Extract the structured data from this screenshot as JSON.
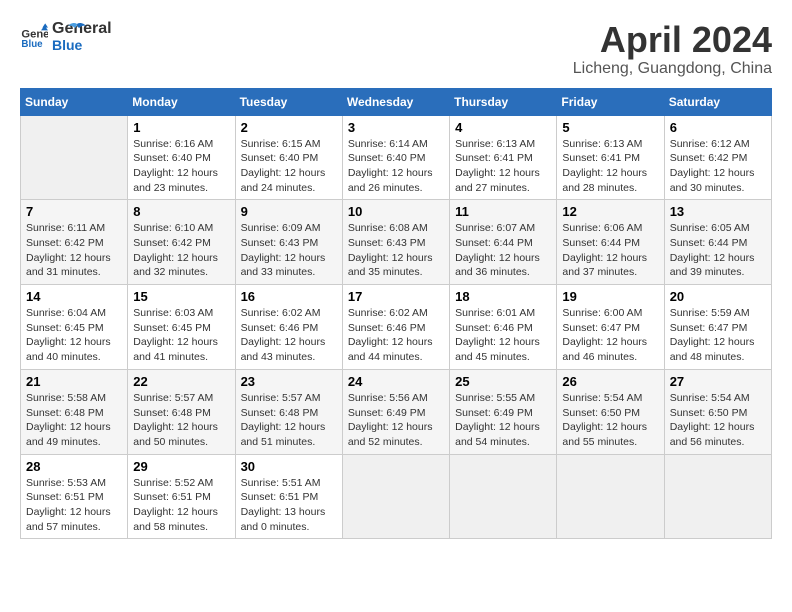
{
  "header": {
    "logo_line1": "General",
    "logo_line2": "Blue",
    "month": "April 2024",
    "location": "Licheng, Guangdong, China"
  },
  "weekdays": [
    "Sunday",
    "Monday",
    "Tuesday",
    "Wednesday",
    "Thursday",
    "Friday",
    "Saturday"
  ],
  "weeks": [
    [
      {
        "day": "",
        "sunrise": "",
        "sunset": "",
        "daylight": "",
        "empty": true
      },
      {
        "day": "1",
        "sunrise": "6:16 AM",
        "sunset": "6:40 PM",
        "daylight": "12 hours and 23 minutes."
      },
      {
        "day": "2",
        "sunrise": "6:15 AM",
        "sunset": "6:40 PM",
        "daylight": "12 hours and 24 minutes."
      },
      {
        "day": "3",
        "sunrise": "6:14 AM",
        "sunset": "6:40 PM",
        "daylight": "12 hours and 26 minutes."
      },
      {
        "day": "4",
        "sunrise": "6:13 AM",
        "sunset": "6:41 PM",
        "daylight": "12 hours and 27 minutes."
      },
      {
        "day": "5",
        "sunrise": "6:13 AM",
        "sunset": "6:41 PM",
        "daylight": "12 hours and 28 minutes."
      },
      {
        "day": "6",
        "sunrise": "6:12 AM",
        "sunset": "6:42 PM",
        "daylight": "12 hours and 30 minutes."
      }
    ],
    [
      {
        "day": "7",
        "sunrise": "6:11 AM",
        "sunset": "6:42 PM",
        "daylight": "12 hours and 31 minutes."
      },
      {
        "day": "8",
        "sunrise": "6:10 AM",
        "sunset": "6:42 PM",
        "daylight": "12 hours and 32 minutes."
      },
      {
        "day": "9",
        "sunrise": "6:09 AM",
        "sunset": "6:43 PM",
        "daylight": "12 hours and 33 minutes."
      },
      {
        "day": "10",
        "sunrise": "6:08 AM",
        "sunset": "6:43 PM",
        "daylight": "12 hours and 35 minutes."
      },
      {
        "day": "11",
        "sunrise": "6:07 AM",
        "sunset": "6:44 PM",
        "daylight": "12 hours and 36 minutes."
      },
      {
        "day": "12",
        "sunrise": "6:06 AM",
        "sunset": "6:44 PM",
        "daylight": "12 hours and 37 minutes."
      },
      {
        "day": "13",
        "sunrise": "6:05 AM",
        "sunset": "6:44 PM",
        "daylight": "12 hours and 39 minutes."
      }
    ],
    [
      {
        "day": "14",
        "sunrise": "6:04 AM",
        "sunset": "6:45 PM",
        "daylight": "12 hours and 40 minutes."
      },
      {
        "day": "15",
        "sunrise": "6:03 AM",
        "sunset": "6:45 PM",
        "daylight": "12 hours and 41 minutes."
      },
      {
        "day": "16",
        "sunrise": "6:02 AM",
        "sunset": "6:46 PM",
        "daylight": "12 hours and 43 minutes."
      },
      {
        "day": "17",
        "sunrise": "6:02 AM",
        "sunset": "6:46 PM",
        "daylight": "12 hours and 44 minutes."
      },
      {
        "day": "18",
        "sunrise": "6:01 AM",
        "sunset": "6:46 PM",
        "daylight": "12 hours and 45 minutes."
      },
      {
        "day": "19",
        "sunrise": "6:00 AM",
        "sunset": "6:47 PM",
        "daylight": "12 hours and 46 minutes."
      },
      {
        "day": "20",
        "sunrise": "5:59 AM",
        "sunset": "6:47 PM",
        "daylight": "12 hours and 48 minutes."
      }
    ],
    [
      {
        "day": "21",
        "sunrise": "5:58 AM",
        "sunset": "6:48 PM",
        "daylight": "12 hours and 49 minutes."
      },
      {
        "day": "22",
        "sunrise": "5:57 AM",
        "sunset": "6:48 PM",
        "daylight": "12 hours and 50 minutes."
      },
      {
        "day": "23",
        "sunrise": "5:57 AM",
        "sunset": "6:48 PM",
        "daylight": "12 hours and 51 minutes."
      },
      {
        "day": "24",
        "sunrise": "5:56 AM",
        "sunset": "6:49 PM",
        "daylight": "12 hours and 52 minutes."
      },
      {
        "day": "25",
        "sunrise": "5:55 AM",
        "sunset": "6:49 PM",
        "daylight": "12 hours and 54 minutes."
      },
      {
        "day": "26",
        "sunrise": "5:54 AM",
        "sunset": "6:50 PM",
        "daylight": "12 hours and 55 minutes."
      },
      {
        "day": "27",
        "sunrise": "5:54 AM",
        "sunset": "6:50 PM",
        "daylight": "12 hours and 56 minutes."
      }
    ],
    [
      {
        "day": "28",
        "sunrise": "5:53 AM",
        "sunset": "6:51 PM",
        "daylight": "12 hours and 57 minutes."
      },
      {
        "day": "29",
        "sunrise": "5:52 AM",
        "sunset": "6:51 PM",
        "daylight": "12 hours and 58 minutes."
      },
      {
        "day": "30",
        "sunrise": "5:51 AM",
        "sunset": "6:51 PM",
        "daylight": "13 hours and 0 minutes."
      },
      {
        "day": "",
        "sunrise": "",
        "sunset": "",
        "daylight": "",
        "empty": true
      },
      {
        "day": "",
        "sunrise": "",
        "sunset": "",
        "daylight": "",
        "empty": true
      },
      {
        "day": "",
        "sunrise": "",
        "sunset": "",
        "daylight": "",
        "empty": true
      },
      {
        "day": "",
        "sunrise": "",
        "sunset": "",
        "daylight": "",
        "empty": true
      }
    ]
  ],
  "labels": {
    "sunrise_prefix": "Sunrise: ",
    "sunset_prefix": "Sunset: ",
    "daylight_prefix": "Daylight: "
  }
}
